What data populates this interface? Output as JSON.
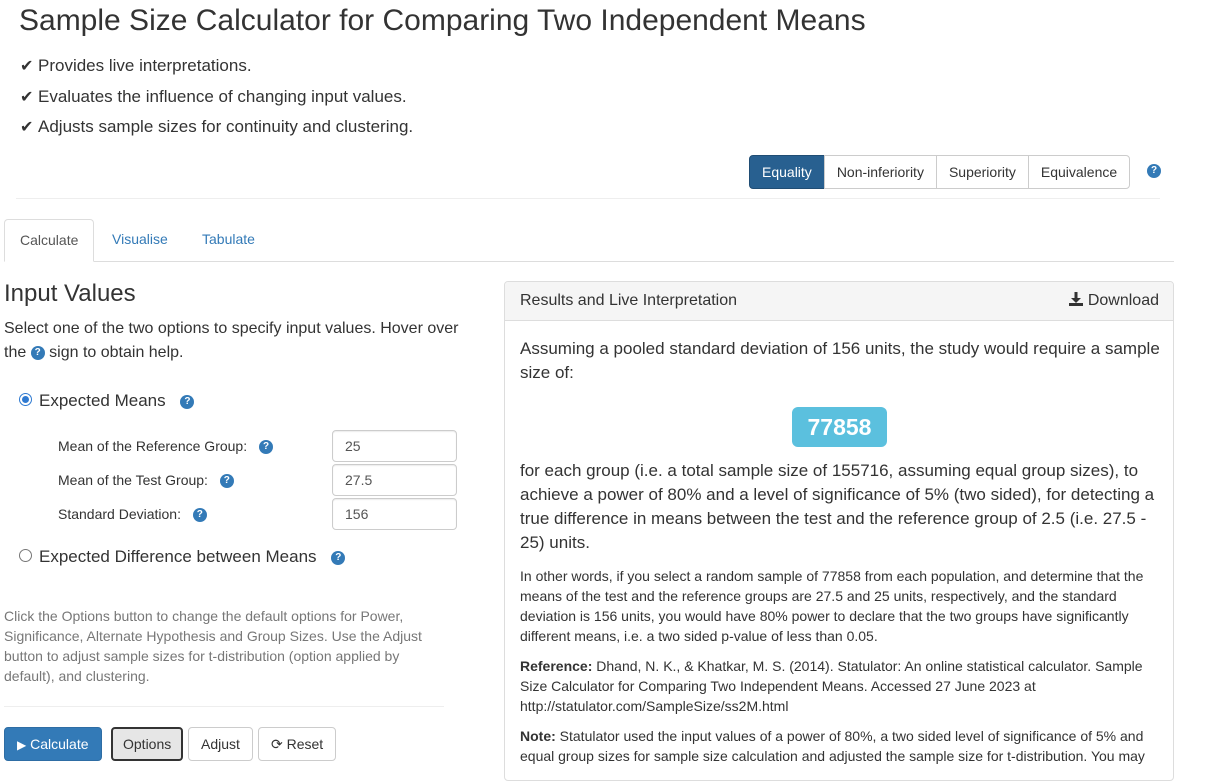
{
  "page": {
    "title": "Sample Size Calculator for Comparing Two Independent Means",
    "features": [
      "Provides live interpretations.",
      "Evaluates the influence of changing input values.",
      "Adjusts sample sizes for continuity and clustering."
    ]
  },
  "hypothesis_types": {
    "options": [
      "Equality",
      "Non-inferiority",
      "Superiority",
      "Equivalence"
    ],
    "selected": "Equality"
  },
  "tabs": [
    "Calculate",
    "Visualise",
    "Tabulate"
  ],
  "active_tab": "Calculate",
  "input": {
    "title": "Input Values",
    "instructions_before": "Select one of the two options to specify input values. Hover over the",
    "instructions_after": "sign to obtain help.",
    "option_means": "Expected Means",
    "option_difference": "Expected Difference between Means",
    "selected_option": "Expected Means",
    "fields": {
      "reference_label": "Mean of the Reference Group:",
      "reference_value": "25",
      "test_label": "Mean of the Test Group:",
      "test_value": "27.5",
      "sd_label": "Standard Deviation:",
      "sd_value": "156"
    },
    "note": "Click the Options button to change the default options for Power, Significance, Alternate Hypothesis and Group Sizes. Use the Adjust button to adjust sample sizes for t-distribution (option applied by default), and clustering."
  },
  "buttons": {
    "calculate": "Calculate",
    "options": "Options",
    "adjust": "Adjust",
    "reset": "Reset"
  },
  "results": {
    "title": "Results and Live Interpretation",
    "download": "Download",
    "intro": "Assuming a pooled standard deviation of 156 units, the study would require a sample size of:",
    "sample_size": "77858",
    "after": "for each group (i.e. a total sample size of 155716, assuming equal group sizes), to achieve a power of 80% and a level of significance of 5% (two sided), for detecting a true difference in means between the test and the reference group of 2.5 (i.e. 27.5 - 25) units.",
    "other_words": "In other words, if you select a random sample of 77858 from each population, and determine that the means of the test and the reference groups are 27.5 and 25 units, respectively, and the standard deviation is 156 units, you would have 80% power to declare that the two groups have significantly different means, i.e. a two sided p-value of less than 0.05.",
    "reference_label": "Reference:",
    "reference_text": "Dhand, N. K., & Khatkar, M. S. (2014). Statulator: An online statistical calculator. Sample Size Calculator for Comparing Two Independent Means. Accessed 27 June 2023 at http://statulator.com/SampleSize/ss2M.html",
    "note_label": "Note:",
    "note_text": "Statulator used the input values of a power of 80%, a two sided level of significance of 5% and equal group sizes for sample size calculation and adjusted the sample size for t-distribution. You may"
  },
  "colors": {
    "primary": "#337ab7",
    "active_segment": "#286090",
    "badge": "#5bc0de"
  },
  "icons": [
    "check-icon",
    "help-icon",
    "download-icon",
    "play-icon",
    "refresh-icon",
    "radio-icon"
  ]
}
